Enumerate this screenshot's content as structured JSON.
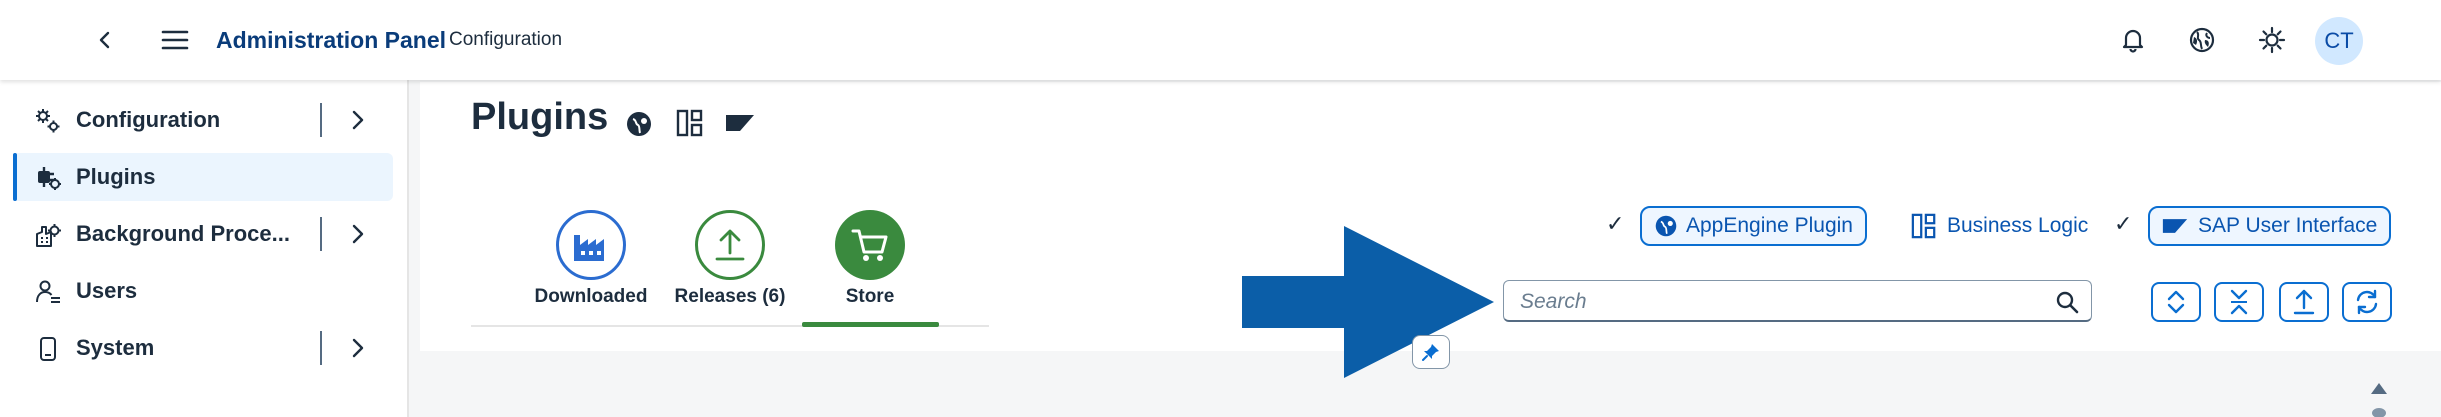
{
  "shellbar": {
    "title": "Administration Panel",
    "subtitle": "Configuration",
    "avatar_initials": "CT",
    "icons": [
      "back-icon",
      "menu-icon",
      "notifications-icon",
      "globe-icon",
      "theme-icon"
    ]
  },
  "sidebar": {
    "items": [
      {
        "label": "Configuration",
        "icon": "gears-icon",
        "expandable": true,
        "selected": false
      },
      {
        "label": "Plugins",
        "icon": "plugins-icon",
        "expandable": false,
        "selected": true
      },
      {
        "label": "Background Proce...",
        "icon": "background-process-icon",
        "expandable": true,
        "selected": false
      },
      {
        "label": "Users",
        "icon": "users-icon",
        "expandable": false,
        "selected": false
      },
      {
        "label": "System",
        "icon": "system-icon",
        "expandable": true,
        "selected": false
      }
    ]
  },
  "page": {
    "title": "Plugins"
  },
  "tabs": [
    {
      "label": "Downloaded",
      "icon": "factory-icon",
      "color": "#2b6cd0"
    },
    {
      "label": "Releases (6)",
      "icon": "upload-icon",
      "color": "#3a8a3e"
    },
    {
      "label": "Store",
      "icon": "cart-icon",
      "color": "#3a8a3e",
      "selected": true
    }
  ],
  "filters": [
    {
      "label": "AppEngine Plugin",
      "checked": true,
      "icon": "appengine-icon"
    },
    {
      "label": "Business Logic",
      "checked": false,
      "icon": "business-logic-icon"
    },
    {
      "label": "SAP User Interface",
      "checked": true,
      "icon": "sap-ui-icon"
    }
  ],
  "search": {
    "placeholder": "Search",
    "value": ""
  },
  "toolbar": {
    "buttons": [
      "expand-all-icon",
      "collapse-all-icon",
      "upload-icon",
      "refresh-icon"
    ]
  },
  "colors": {
    "accent": "#0a6ed1",
    "brand_title": "#0a3c7a",
    "annotation_arrow": "#0b5ea8",
    "store_green": "#3a8a3e"
  }
}
